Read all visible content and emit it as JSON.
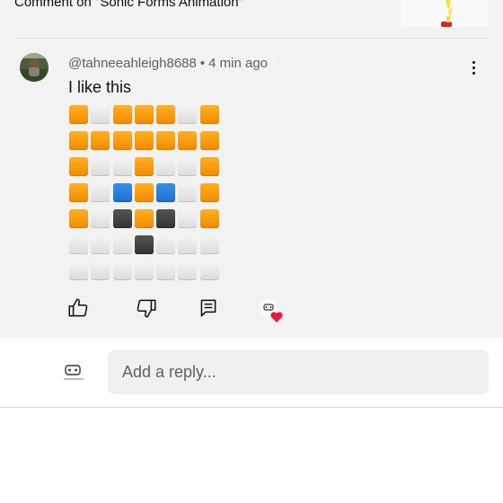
{
  "context": {
    "text": "Comment on \"Sonic Forms Animation\""
  },
  "comment": {
    "author": "@tahneeahleigh8688",
    "separator": "•",
    "time": "4 min ago",
    "text": "I like this",
    "emoji_grid": [
      [
        "orange",
        "white",
        "orange",
        "orange",
        "orange",
        "white",
        "orange"
      ],
      [
        "orange",
        "orange",
        "orange",
        "orange",
        "orange",
        "orange",
        "orange"
      ],
      [
        "orange",
        "white",
        "white",
        "orange",
        "white",
        "white",
        "orange"
      ],
      [
        "orange",
        "white",
        "blue",
        "orange",
        "blue",
        "white",
        "orange"
      ],
      [
        "orange",
        "white",
        "black",
        "orange",
        "black",
        "white",
        "orange"
      ],
      [
        "white",
        "white",
        "white",
        "black",
        "white",
        "white",
        "white"
      ],
      [
        "white",
        "white",
        "white",
        "white",
        "white",
        "white",
        "white"
      ]
    ]
  },
  "actions": {
    "like_icon": "thumbs-up-icon",
    "dislike_icon": "thumbs-down-icon",
    "reply_icon": "comment-reply-icon",
    "creator_heart_icon": "creator-heart-icon"
  },
  "reply": {
    "placeholder": "Add a reply..."
  },
  "colors": {
    "orange": "#f59b12",
    "white": "#e3e3e3",
    "blue": "#2a7fdc",
    "black": "#3a3a3a",
    "heart": "#e8173c",
    "background": "#f2f2f2"
  }
}
